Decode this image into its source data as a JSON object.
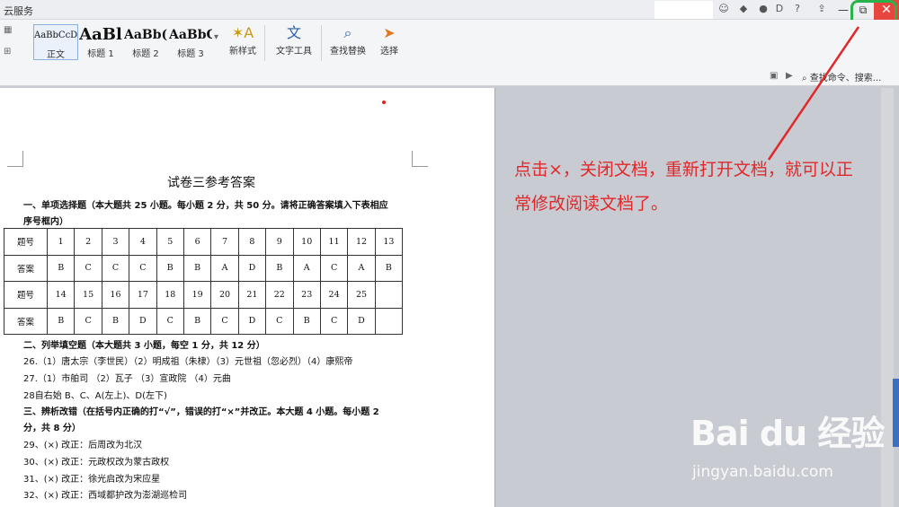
{
  "app": {
    "cloud_label": "云服务"
  },
  "window": {
    "close_glyph": "✕",
    "restore_glyph": "⧉",
    "minimize_glyph": "—"
  },
  "ribbon": {
    "styles": [
      {
        "sample": "AaBbCcDd",
        "label": "正文"
      },
      {
        "sample": "AaBl",
        "label": "标题 1"
      },
      {
        "sample": "AaBb(",
        "label": "标题 2"
      },
      {
        "sample": "AaBbC",
        "label": "标题 3"
      }
    ],
    "new_style": "新样式",
    "text_tools": "文字工具",
    "find_replace": "查找替换",
    "select": "选择",
    "search_placeholder": "查找命令、搜索..."
  },
  "document": {
    "title": "试卷三参考答案",
    "section1_line1": "一、单项选择题（本大题共 25 小题。每小题 2 分，共 50 分。请将正确答案填入下表相应",
    "section1_line2": "序号框内）",
    "table": {
      "row_labels": [
        "题号",
        "答案",
        "题号",
        "答案"
      ],
      "rows": [
        [
          "1",
          "2",
          "3",
          "4",
          "5",
          "6",
          "7",
          "8",
          "9",
          "10",
          "11",
          "12",
          "13"
        ],
        [
          "B",
          "C",
          "C",
          "C",
          "B",
          "B",
          "A",
          "D",
          "B",
          "A",
          "C",
          "A",
          "B"
        ],
        [
          "14",
          "15",
          "16",
          "17",
          "18",
          "19",
          "20",
          "21",
          "22",
          "23",
          "24",
          "25",
          ""
        ],
        [
          "B",
          "C",
          "B",
          "D",
          "C",
          "B",
          "C",
          "D",
          "C",
          "B",
          "C",
          "D",
          ""
        ]
      ]
    },
    "section2": "二、列举填空题（本大题共 3 小题，每空 1 分，共 12 分）",
    "q26": "26.（1）唐太宗（李世民）（2）明成祖（朱棣）（3）元世祖（忽必烈）（4）康熙帝",
    "q27": "27.（1）市舶司 （2）瓦子 （3）宣政院 （4）元曲",
    "q28": "28自右始 B、C、A(左上)、D(左下)",
    "section3_line1": "三、辨析改错（在括号内正确的打“√”，错误的打“×”并改正。本大题 4 小题。每小题 2",
    "section3_line2": "分，共 8 分）",
    "q29": "29、(×) 改正：后周改为北汉",
    "q30": "30、(×) 改正：元政权改为蒙古政权",
    "q31": "31、(×) 改正：徐光启改为宋应星",
    "q32": "32、(×) 改正：西域都护改为澎湖巡检司"
  },
  "annotation": "点击×，关闭文档，重新打开文档，就可以正常修改阅读文档了。",
  "watermark": {
    "brand": "Bai du 经验",
    "url": "jingyan.baidu.com"
  },
  "colors": {
    "annotation": "#e0282a",
    "highlight_ring": "#28b34a",
    "close_button": "#e6463e"
  }
}
